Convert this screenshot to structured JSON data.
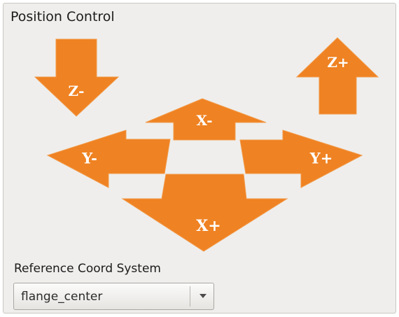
{
  "panel": {
    "title": "Position Control"
  },
  "jog": {
    "color": "#ef8222",
    "buttons": {
      "z_minus": "Z-",
      "z_plus": "Z+",
      "x_minus": "X-",
      "x_plus": "X+",
      "y_minus": "Y-",
      "y_plus": "Y+"
    }
  },
  "reference": {
    "label": "Reference Coord System",
    "selected": "flange_center"
  }
}
